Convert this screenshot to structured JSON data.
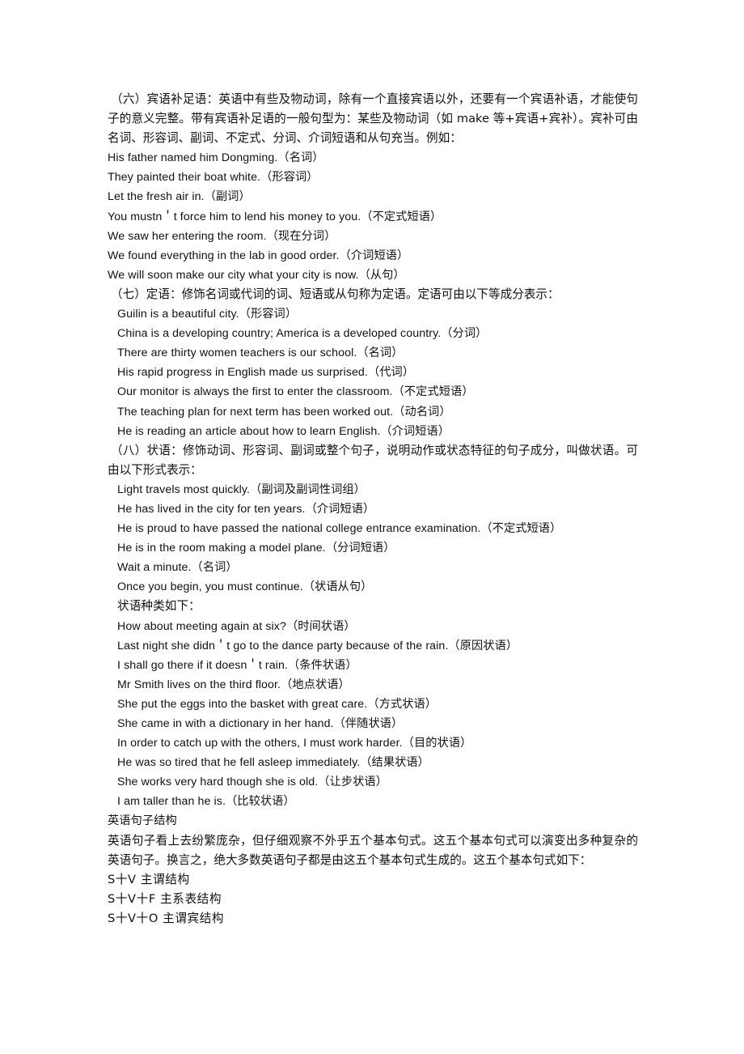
{
  "document": {
    "background_color": "#ffffff",
    "text_color": "#111111",
    "sections": [
      {
        "id": "object-complement",
        "heading_paragraph": "（六）宾语补足语：英语中有些及物动词，除有一个直接宾语以外，还要有一个宾语补语，才能使句子的意义完整。带有宾语补足语的一般句型为：某些及物动词（如 make 等+宾语+宾补）。宾补可由名词、形容词、副词、不定式、分词、介词短语和从句充当。例如：",
        "examples": [
          "His father named him Dongming.（名词）",
          "They painted their boat white.（形容词）",
          "Let the fresh air in.（副词）",
          "You mustn＇t force him to lend his money to you.（不定式短语）",
          "We saw her entering the room.（现在分词）",
          "We found everything in the lab in good order.（介词短语）",
          "We will soon make our city what your city is now.（从句）"
        ]
      },
      {
        "id": "attributive",
        "heading_paragraph": "（七）定语：修饰名词或代词的词、短语或从句称为定语。定语可由以下等成分表示：",
        "examples": [
          "Guilin is a beautiful city.（形容词）",
          "China is a developing country; America is a developed country.（分词）",
          "There are thirty women teachers is our school.（名词）",
          "His rapid progress in English made us surprised.（代词）",
          "Our monitor is always the first to enter the classroom.（不定式短语）",
          "The teaching plan for next term has been worked out.（动名词）",
          "He is reading an article about how to learn English.（介词短语）"
        ]
      },
      {
        "id": "adverbial",
        "heading_paragraph": "（八）状语：修饰动词、形容词、副词或整个句子，说明动作或状态特征的句子成分，叫做状语。可由以下形式表示：",
        "examples": [
          "Light travels most quickly.（副词及副词性词组）",
          "He has lived in the city for ten years.（介词短语）",
          "He is proud to have passed the national college entrance examination.（不定式短语）",
          "He is in the room making a model plane.（分词短语）",
          "Wait a minute.（名词）",
          "Once you begin, you must continue.（状语从句）"
        ],
        "subsection_label": "状语种类如下：",
        "type_examples": [
          "How about meeting again at six?（时间状语）",
          "Last night she didn＇t go to the dance party because of the rain.（原因状语）",
          "I shall go there if it doesn＇t rain.（条件状语）",
          "Mr Smith lives on the third floor.（地点状语）",
          "She put the eggs into the basket with great care.（方式状语）",
          "She came in with a dictionary in her hand.（伴随状语）",
          "In order to catch up with the others, I must work harder.（目的状语）",
          "He was so tired that he fell asleep immediately.（结果状语）",
          "She works very hard though she is old.（让步状语）",
          "I am taller than he is.（比较状语）"
        ]
      },
      {
        "id": "sentence-structure",
        "title": "英语句子结构",
        "body_paragraph": "英语句子看上去纷繁庞杂，但仔细观察不外乎五个基本句式。这五个基本句式可以演变出多种复杂的英语句子。换言之，绝大多数英语句子都是由这五个基本句式生成的。这五个基本句式如下：",
        "patterns": [
          "S十V 主谓结构",
          "S十V十F 主系表结构",
          "S十V十O 主谓宾结构"
        ]
      }
    ]
  }
}
